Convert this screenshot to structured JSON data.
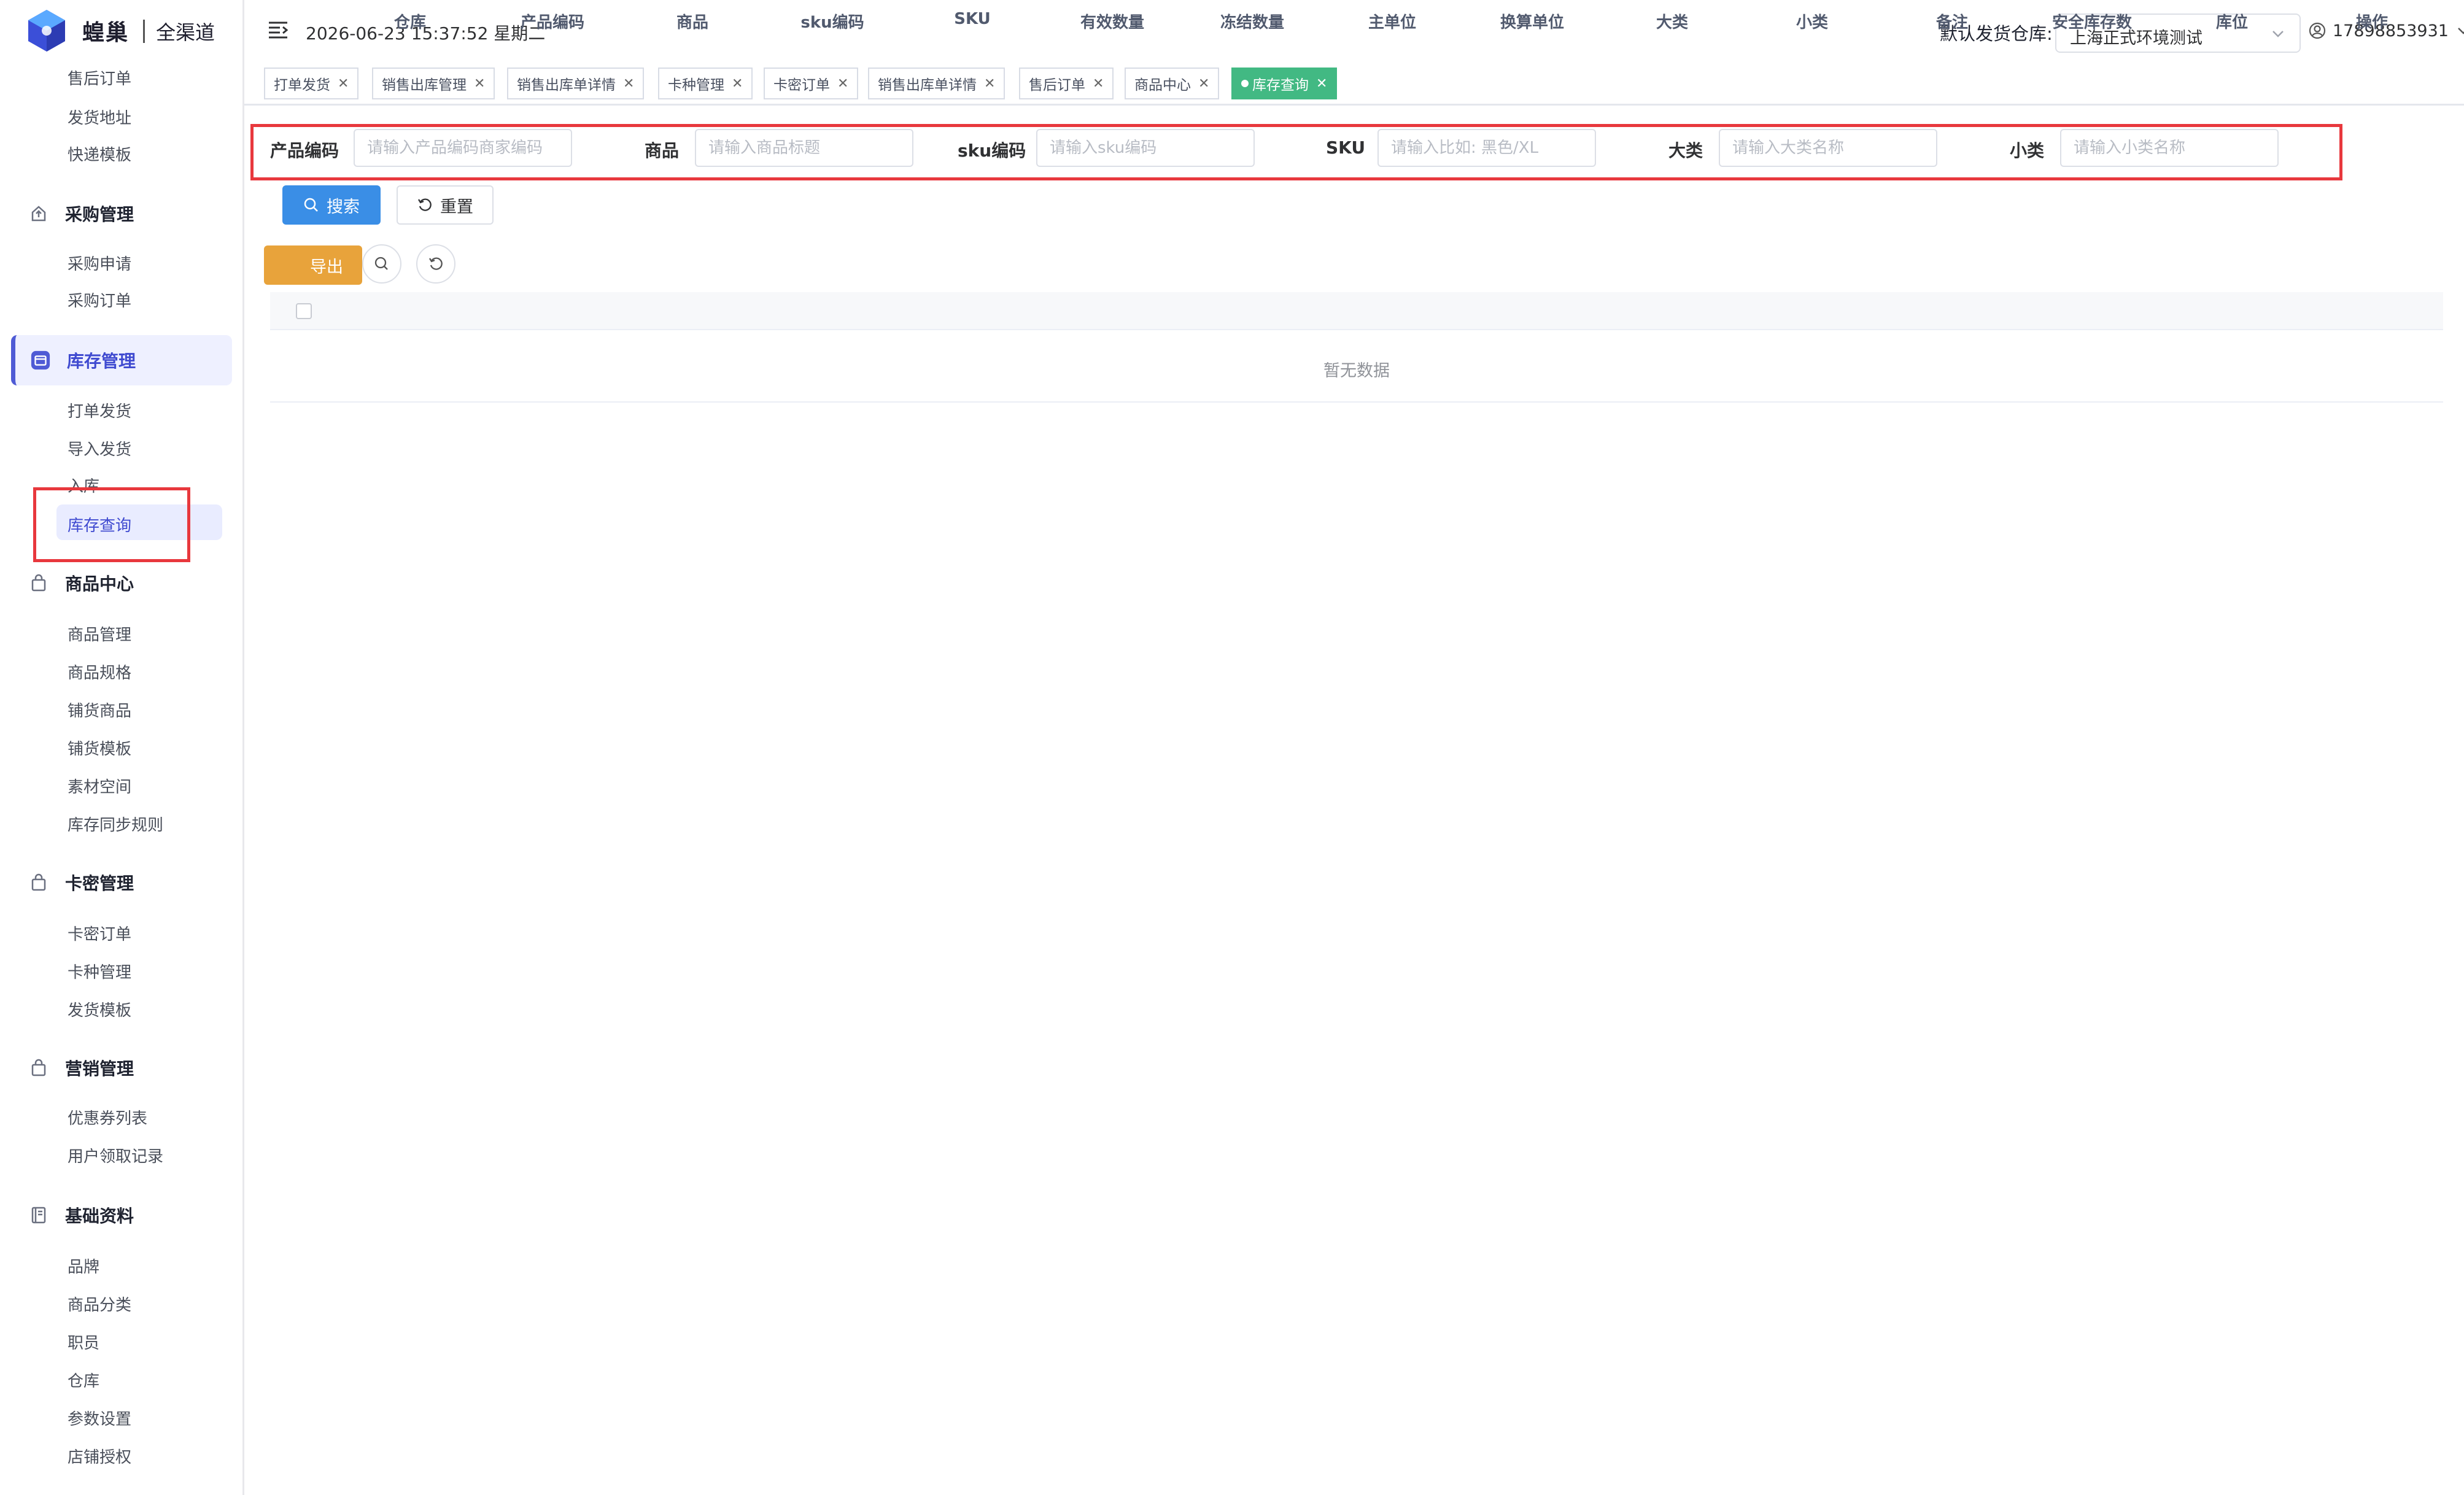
{
  "brand": {
    "name": "蝗巢",
    "sub": "全渠道"
  },
  "sidebar": {
    "pre_items": [
      "售后订单",
      "发货地址",
      "快递模板"
    ],
    "groups": [
      {
        "label": "采购管理",
        "icon": "purchase-icon",
        "items": [
          "采购申请",
          "采购订单"
        ]
      },
      {
        "label": "库存管理",
        "icon": "inventory-icon",
        "items": [
          "打单发货",
          "导入发货",
          "入库",
          "库存查询"
        ],
        "active": true,
        "active_item": "库存查询"
      },
      {
        "label": "商品中心",
        "icon": "bag-icon",
        "items": [
          "商品管理",
          "商品规格",
          "铺货商品",
          "铺货模板",
          "素材空间",
          "库存同步规则"
        ]
      },
      {
        "label": "卡密管理",
        "icon": "bag-icon",
        "items": [
          "卡密订单",
          "卡种管理",
          "发货模板"
        ]
      },
      {
        "label": "营销管理",
        "icon": "bag-icon",
        "items": [
          "优惠券列表",
          "用户领取记录"
        ]
      },
      {
        "label": "基础资料",
        "icon": "book-icon",
        "items": [
          "品牌",
          "商品分类",
          "职员",
          "仓库",
          "参数设置",
          "店铺授权"
        ]
      }
    ]
  },
  "header": {
    "datetime": "2026-06-23 15:37:52 星期二",
    "warehouse_label": "默认发货仓库:",
    "warehouse_value": "上海正式环境测试",
    "user": "17898853931"
  },
  "tabs": [
    {
      "label": "打单发货"
    },
    {
      "label": "销售出库管理"
    },
    {
      "label": "销售出库单详情"
    },
    {
      "label": "卡种管理"
    },
    {
      "label": "卡密订单"
    },
    {
      "label": "销售出库单详情"
    },
    {
      "label": "售后订单"
    },
    {
      "label": "商品中心"
    },
    {
      "label": "库存查询",
      "active": true
    }
  ],
  "filters": [
    {
      "label": "产品编码",
      "placeholder": "请输入产品编码商家编码"
    },
    {
      "label": "商品",
      "placeholder": "请输入商品标题"
    },
    {
      "label": "sku编码",
      "placeholder": "请输入sku编码"
    },
    {
      "label": "SKU",
      "placeholder": "请输入比如: 黑色/XL"
    },
    {
      "label": "大类",
      "placeholder": "请输入大类名称"
    },
    {
      "label": "小类",
      "placeholder": "请输入小类名称"
    }
  ],
  "buttons": {
    "search": "搜索",
    "reset": "重置",
    "export": "导出"
  },
  "table": {
    "columns": [
      "仓库",
      "产品编码",
      "商品",
      "sku编码",
      "SKU",
      "有效数量",
      "冻结数量",
      "主单位",
      "换算单位",
      "大类",
      "小类",
      "备注",
      "安全库存数",
      "库位",
      "操作"
    ],
    "empty_text": "暂无数据"
  },
  "colors": {
    "primary": "#3a8ee6",
    "export": "#e8a33b",
    "active_tab": "#42b983",
    "sidebar_active": "#3f4ad0",
    "highlight_box": "#e8383d"
  }
}
